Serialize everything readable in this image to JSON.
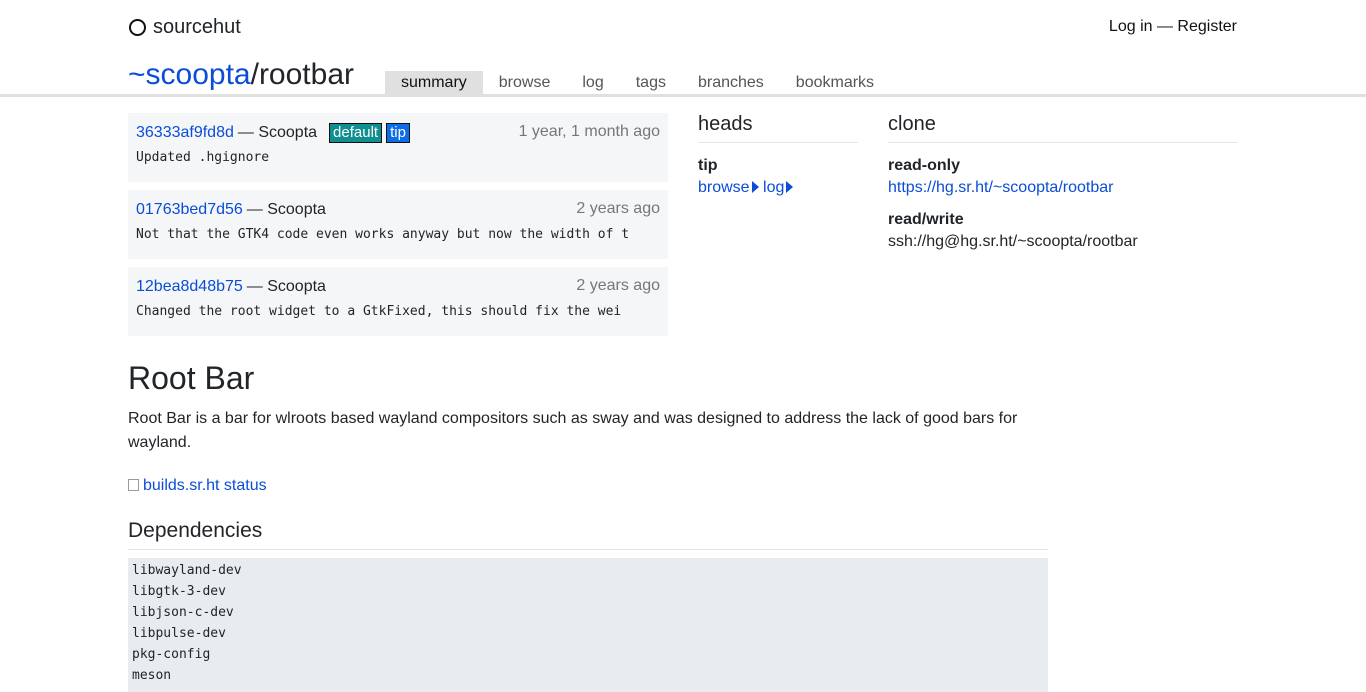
{
  "brand": {
    "name": "sourcehut",
    "icon": "ring-icon"
  },
  "auth": {
    "login": "Log in",
    "separator": "—",
    "register": "Register"
  },
  "repo": {
    "owner": "~scoopta",
    "slash": "/",
    "name": "rootbar"
  },
  "tabs": [
    {
      "label": "summary",
      "active": true
    },
    {
      "label": "browse"
    },
    {
      "label": "log"
    },
    {
      "label": "tags"
    },
    {
      "label": "branches"
    },
    {
      "label": "bookmarks"
    }
  ],
  "commits": [
    {
      "hash": "36333af9fd8d",
      "author": "— Scoopta",
      "badges": [
        "default",
        "tip"
      ],
      "time": "1 year, 1 month ago",
      "message": "Updated .hgignore"
    },
    {
      "hash": "01763bed7d56",
      "author": "— Scoopta",
      "time": "2 years ago",
      "message": "Not that the GTK4 code even works anyway but now the width of t"
    },
    {
      "hash": "12bea8d48b75",
      "author": "— Scoopta",
      "time": "2 years ago",
      "message": "Changed the root widget to a GtkFixed, this should fix the wei"
    }
  ],
  "heads": {
    "title": "heads",
    "name": "tip",
    "browse": "browse",
    "log": "log"
  },
  "clone": {
    "title": "clone",
    "ro_label": "read-only",
    "ro_url": "https://hg.sr.ht/~scoopta/rootbar",
    "rw_label": "read/write",
    "rw_url": "ssh://hg@hg.sr.ht/~scoopta/rootbar"
  },
  "readme": {
    "title": "Root Bar",
    "intro": "Root Bar is a bar for wlroots based wayland compositors such as sway and was designed to address the lack of good bars for wayland.",
    "badge_alt": "builds.sr.ht status",
    "deps_heading": "Dependencies",
    "deps": "libwayland-dev\nlibgtk-3-dev\nlibjson-c-dev\nlibpulse-dev\npkg-config\nmeson"
  }
}
